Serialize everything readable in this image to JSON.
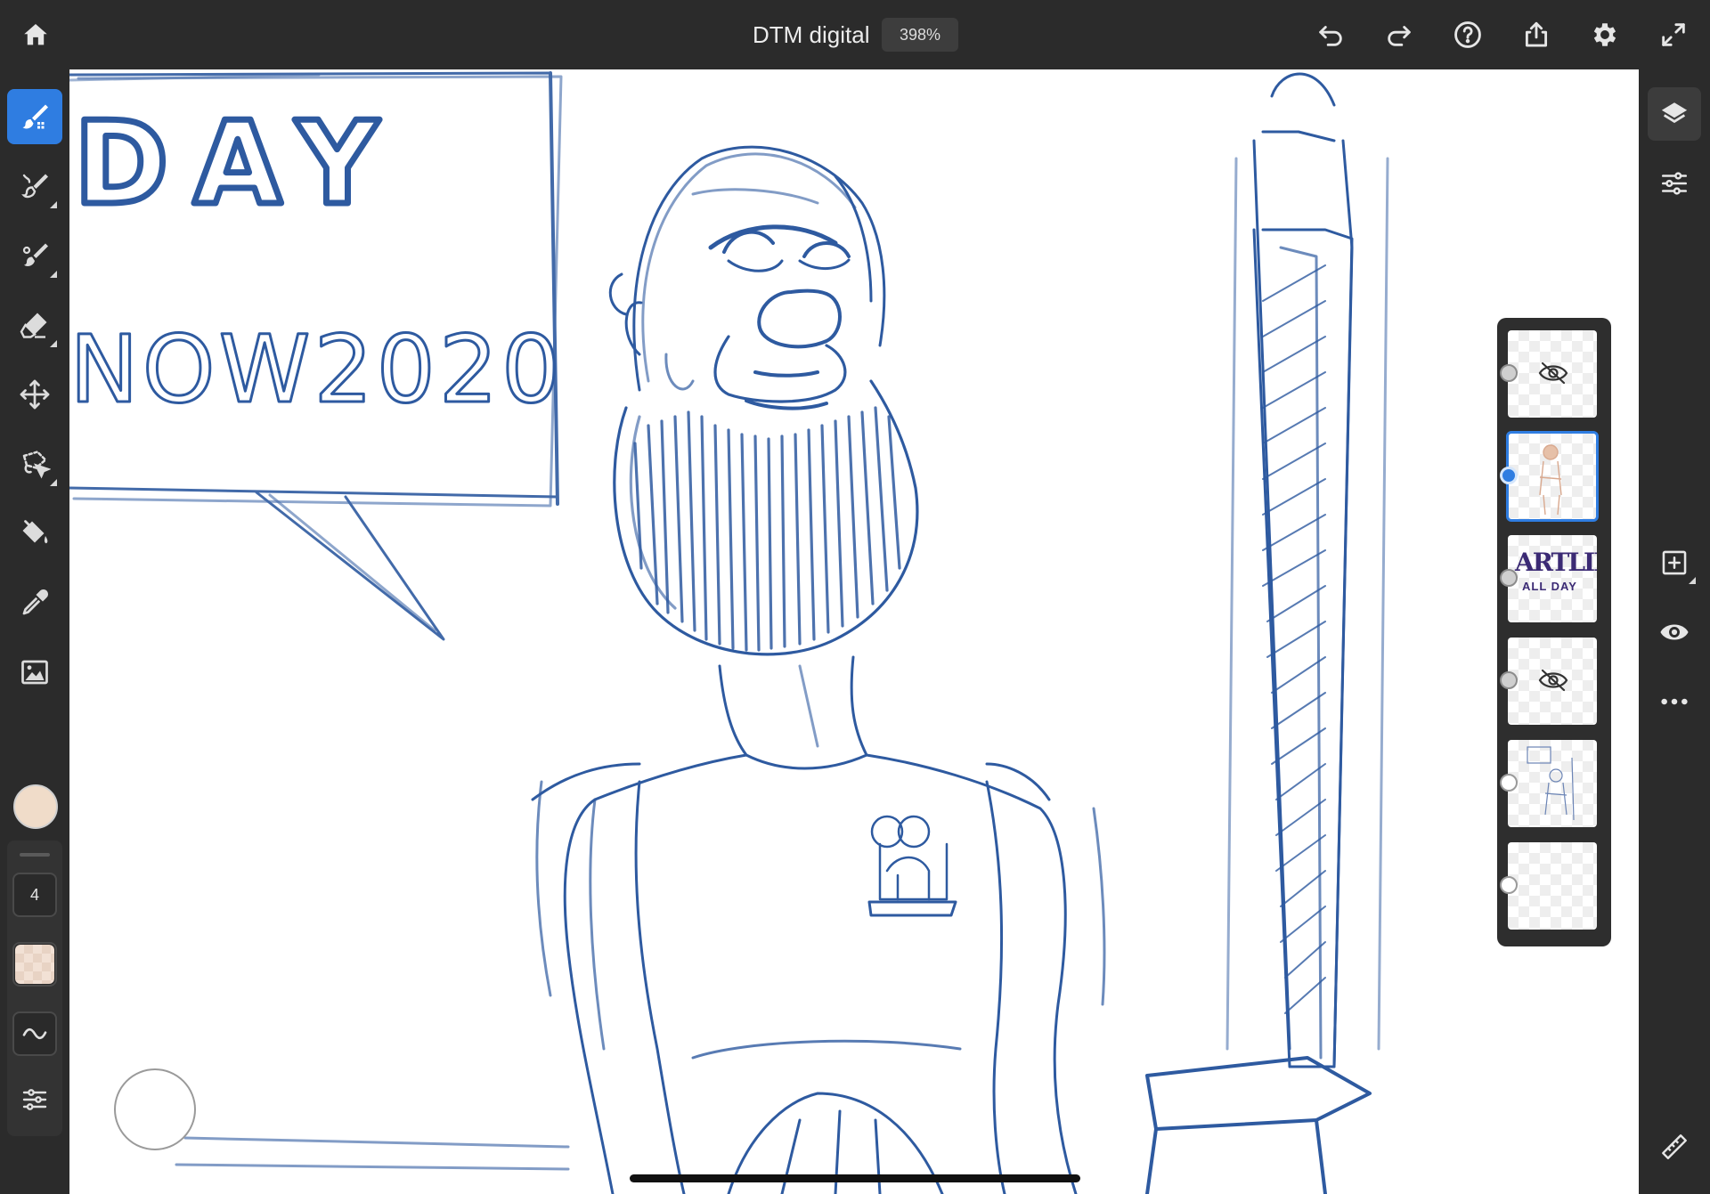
{
  "app": {
    "document_title": "DTM digital",
    "zoom": "398%"
  },
  "top_toolbar": {
    "left": [
      "home-icon"
    ],
    "right": [
      "undo-icon",
      "redo-icon",
      "help-icon",
      "share-icon",
      "settings-icon",
      "fullscreen-icon"
    ]
  },
  "left_toolbar": {
    "tools": [
      {
        "name": "pixel-brush",
        "icon": "pixel-brush-icon",
        "active": true
      },
      {
        "name": "live-brush",
        "icon": "live-brush-icon",
        "active": false
      },
      {
        "name": "vector-brush",
        "icon": "vector-brush-icon",
        "active": false
      },
      {
        "name": "eraser",
        "icon": "eraser-icon",
        "active": false
      },
      {
        "name": "transform",
        "icon": "move-icon",
        "active": false
      },
      {
        "name": "lasso-selection",
        "icon": "lasso-icon",
        "active": false
      },
      {
        "name": "fill",
        "icon": "paint-bucket-icon",
        "active": false
      },
      {
        "name": "eyedropper",
        "icon": "eyedropper-icon",
        "active": false
      },
      {
        "name": "place-image",
        "icon": "image-icon",
        "active": false
      }
    ],
    "current_color": "#f0dcc9",
    "brush_size": "4",
    "opacity_swatch_color": "#f2e1d5",
    "smoothing_icon": "wave-icon",
    "brush_settings_icon": "sliders-icon"
  },
  "canvas": {
    "sign_text_line1": "DAY",
    "sign_text_line2": "NOW2020",
    "stroke_color": "#2e5aa0"
  },
  "layers": [
    {
      "id": 1,
      "visibility": "hidden",
      "selected": false,
      "thumb": "figure-sketch"
    },
    {
      "id": 2,
      "visibility": "visible",
      "selected": true,
      "thumb": "figure-color"
    },
    {
      "id": 3,
      "visibility": "visible",
      "selected": false,
      "thumb": "lettering",
      "text_line1": "ARTLIFE",
      "text_line2": "ALL DAY"
    },
    {
      "id": 4,
      "visibility": "hidden",
      "selected": false,
      "thumb": "figure-sketch"
    },
    {
      "id": 5,
      "visibility": "visible",
      "selected": false,
      "thumb": "group"
    },
    {
      "id": 6,
      "visibility": "visible",
      "selected": false,
      "thumb": "image-layer"
    }
  ],
  "right_toolbar": [
    "layers-icon",
    "adjustments-icon",
    "add-layer-icon",
    "visibility-icon",
    "more-icon",
    "ruler-icon"
  ]
}
